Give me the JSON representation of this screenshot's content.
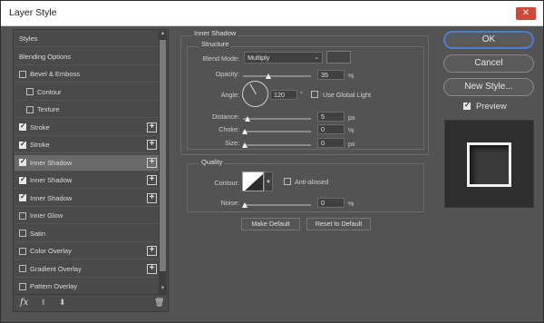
{
  "window": {
    "title": "Layer Style",
    "close_glyph": "✕"
  },
  "sidebar": {
    "items": [
      {
        "label": "Styles",
        "checkbox": "none",
        "checked": false,
        "plus": false,
        "selected": false
      },
      {
        "label": "Blending Options",
        "checkbox": "none",
        "checked": false,
        "plus": false,
        "selected": false
      },
      {
        "label": "Bevel & Emboss",
        "checkbox": "top",
        "checked": false,
        "plus": false,
        "selected": false
      },
      {
        "label": "Contour",
        "checkbox": "sub",
        "checked": false,
        "plus": false,
        "selected": false
      },
      {
        "label": "Texture",
        "checkbox": "sub",
        "checked": false,
        "plus": false,
        "selected": false
      },
      {
        "label": "Stroke",
        "checkbox": "top",
        "checked": true,
        "plus": true,
        "selected": false
      },
      {
        "label": "Stroke",
        "checkbox": "top",
        "checked": true,
        "plus": true,
        "selected": false
      },
      {
        "label": "Inner Shadow",
        "checkbox": "top",
        "checked": true,
        "plus": true,
        "selected": true
      },
      {
        "label": "Inner Shadow",
        "checkbox": "top",
        "checked": true,
        "plus": true,
        "selected": false
      },
      {
        "label": "Inner Shadow",
        "checkbox": "top",
        "checked": true,
        "plus": true,
        "selected": false
      },
      {
        "label": "Inner Glow",
        "checkbox": "top",
        "checked": false,
        "plus": false,
        "selected": false
      },
      {
        "label": "Satin",
        "checkbox": "top",
        "checked": false,
        "plus": false,
        "selected": false
      },
      {
        "label": "Color Overlay",
        "checkbox": "top",
        "checked": false,
        "plus": true,
        "selected": false
      },
      {
        "label": "Gradient Overlay",
        "checkbox": "top",
        "checked": false,
        "plus": true,
        "selected": false
      },
      {
        "label": "Pattern Overlay",
        "checkbox": "top",
        "checked": false,
        "plus": false,
        "selected": false
      }
    ],
    "footer": {
      "fx": "fx",
      "up": "⬆",
      "down": "⬇",
      "trash": "🗑"
    }
  },
  "panel": {
    "heading": "Inner Shadow",
    "structure": {
      "title": "Structure",
      "blend_mode_label": "Blend Mode:",
      "blend_mode_value": "Multiply",
      "opacity_label": "Opacity:",
      "opacity_value": "35",
      "opacity_unit": "%",
      "angle_label": "Angle:",
      "angle_value": "120",
      "angle_unit": "°",
      "global_light_label": "Use Global Light",
      "global_light_checked": false,
      "distance_label": "Distance:",
      "distance_value": "5",
      "distance_unit": "px",
      "choke_label": "Choke:",
      "choke_value": "0",
      "choke_unit": "%",
      "size_label": "Size:",
      "size_value": "0",
      "size_unit": "px"
    },
    "quality": {
      "title": "Quality",
      "contour_label": "Contour:",
      "anti_aliased_label": "Anti-aliased",
      "anti_aliased_checked": false,
      "noise_label": "Noise:",
      "noise_value": "0",
      "noise_unit": "%"
    },
    "make_default": "Make Default",
    "reset_default": "Reset to Default"
  },
  "actions": {
    "ok": "OK",
    "cancel": "Cancel",
    "new_style": "New Style...",
    "preview_label": "Preview",
    "preview_checked": true
  },
  "colors": {
    "accent": "#4d7fd0",
    "close": "#c94b3c",
    "selected_row": "#6a6a6a"
  }
}
